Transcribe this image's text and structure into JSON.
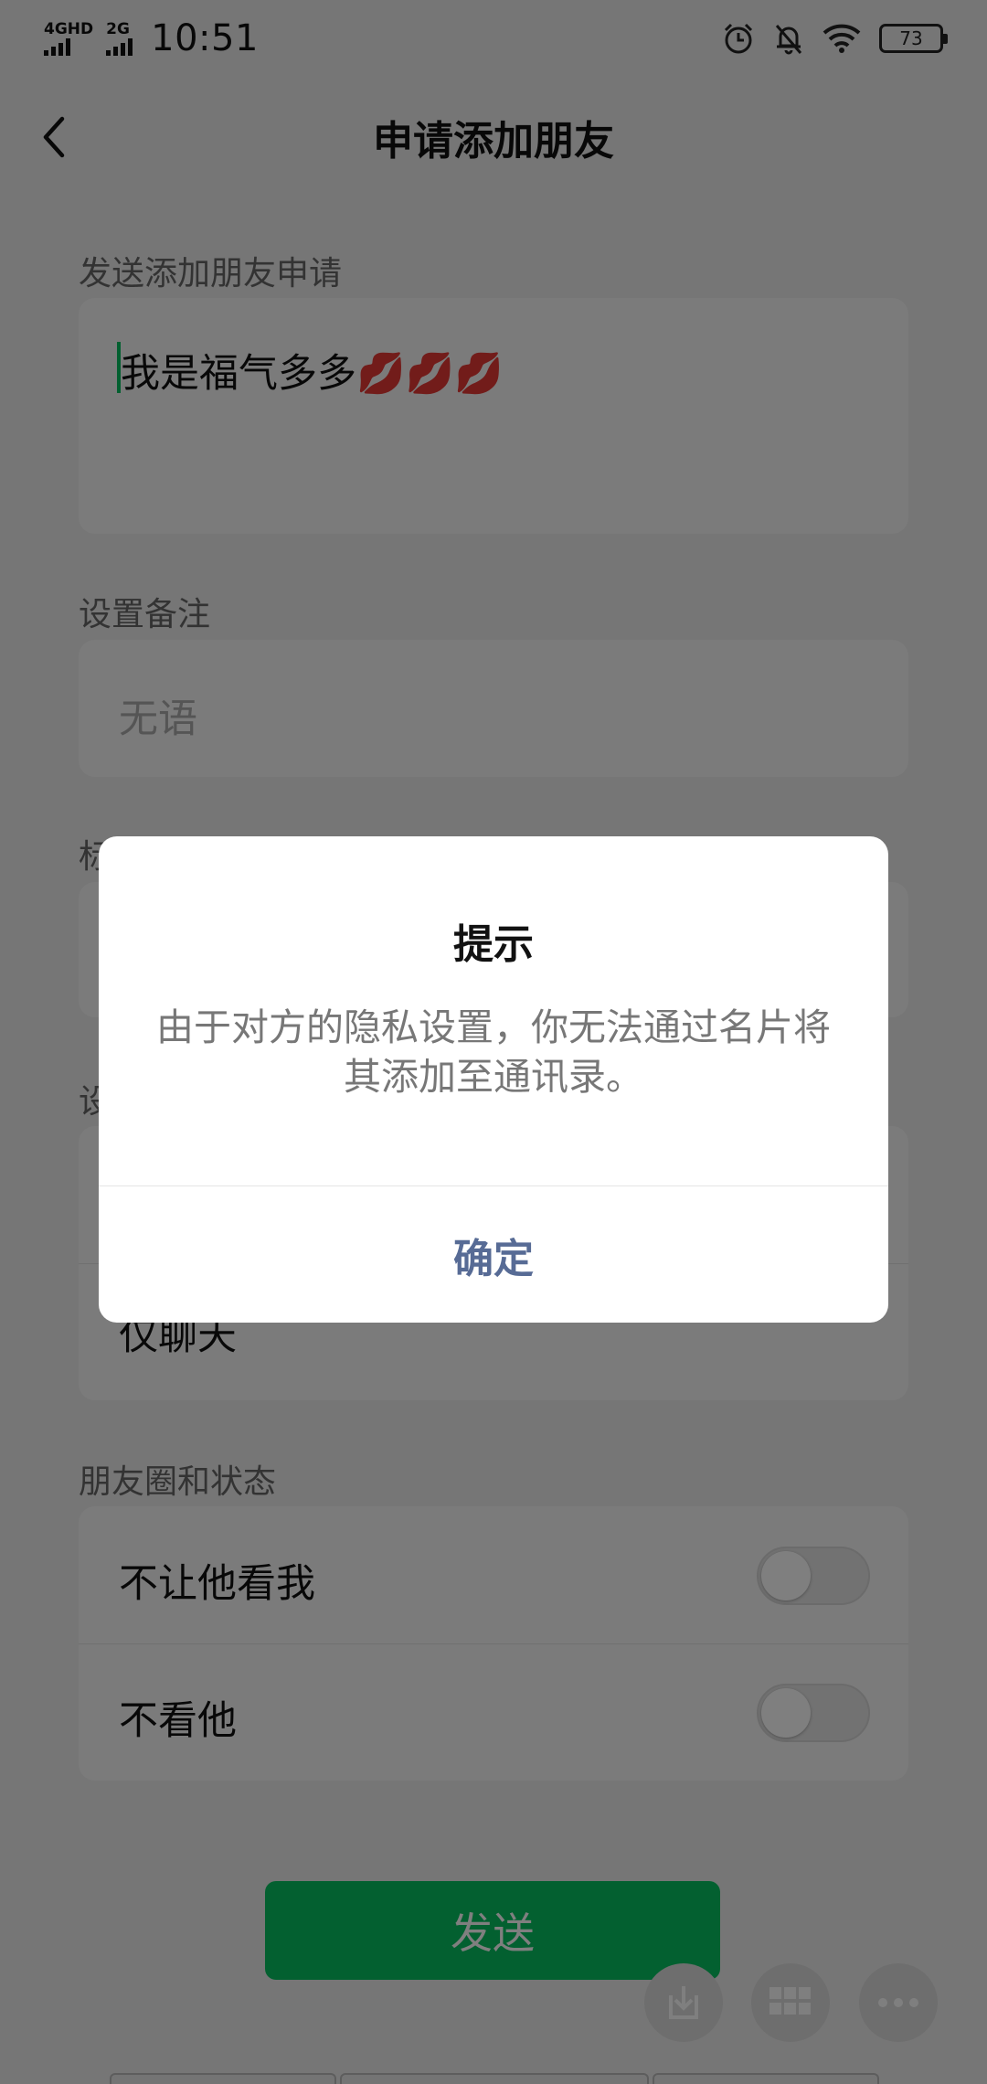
{
  "status_bar": {
    "network1": "4GHD",
    "network2": "2G",
    "time": "10:51",
    "battery": "73"
  },
  "nav": {
    "back_icon": "chevron-left-icon",
    "title": "申请添加朋友"
  },
  "request": {
    "label": "发送添加朋友申请",
    "message": "我是福气多多💋💋💋"
  },
  "remark": {
    "label": "设置备注",
    "placeholder": "无语"
  },
  "tags": {
    "label_partial": "标"
  },
  "permissions": {
    "label_partial": "设",
    "option_partial": "仅聊天"
  },
  "moments": {
    "label": "朋友圈和状态",
    "items": [
      {
        "label": "不让他看我",
        "enabled": false
      },
      {
        "label": "不看他",
        "enabled": false
      }
    ]
  },
  "send_button": "发送",
  "floating": {
    "icons": [
      "download-icon",
      "grid-icon",
      "more-icon"
    ]
  },
  "dialog": {
    "title": "提示",
    "message": "由于对方的隐私设置，你无法通过名片将其添加至通讯录。",
    "confirm": "确定"
  },
  "colors": {
    "accent": "#07c160",
    "dialog_link": "#576b95",
    "overlay": "rgba(0,0,0,0.5)"
  }
}
